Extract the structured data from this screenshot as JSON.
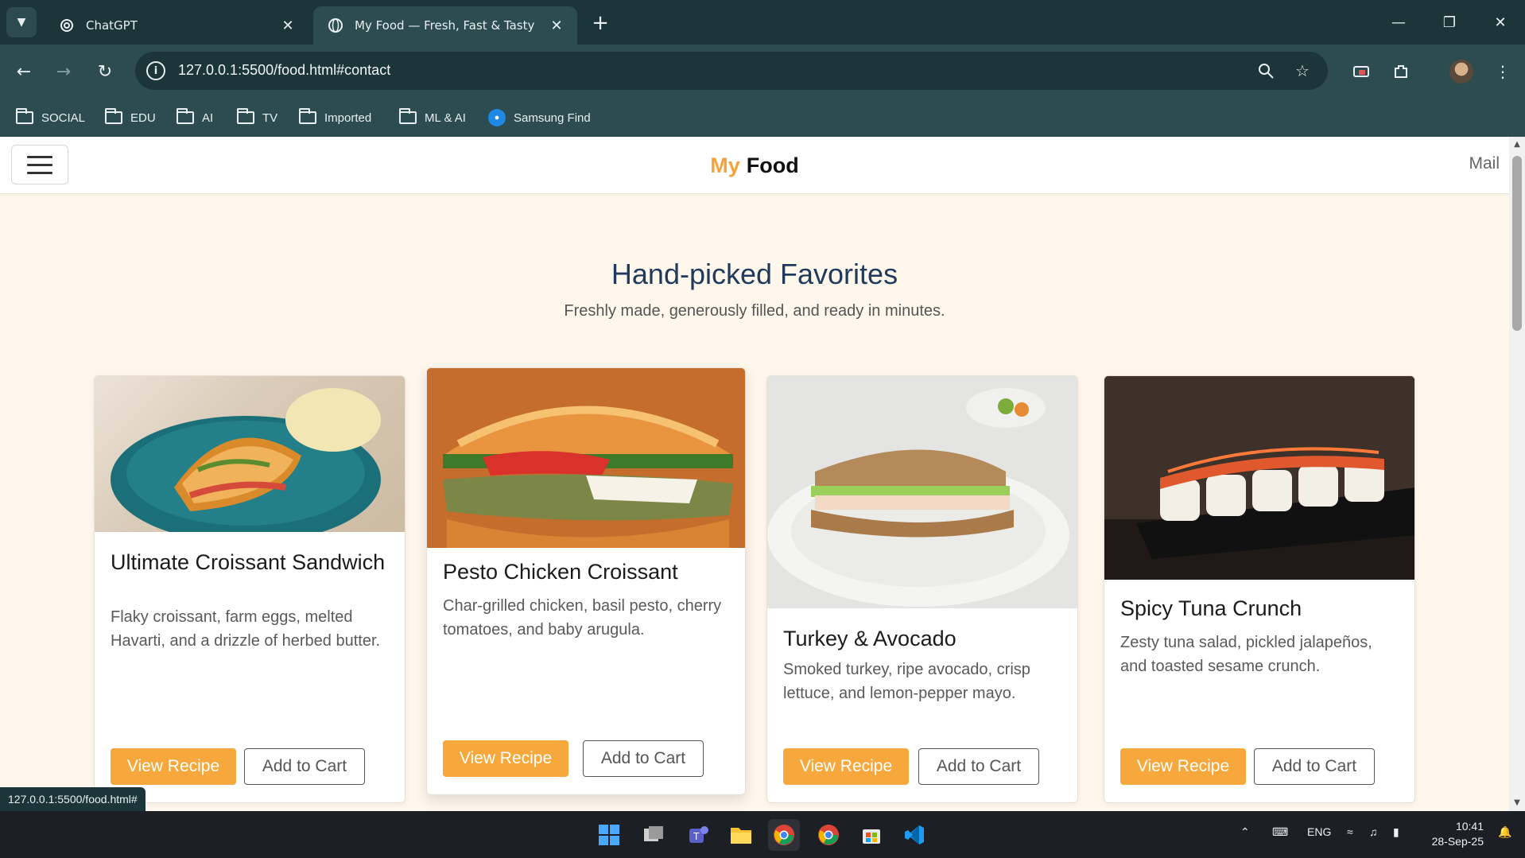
{
  "browser": {
    "tabs": [
      {
        "title": "ChatGPT",
        "active": false
      },
      {
        "title": "My Food — Fresh, Fast & Tasty",
        "active": true
      }
    ],
    "url": "127.0.0.1:5500/food.html#contact",
    "bookmarks": [
      "SOCIAL",
      "EDU",
      "AI",
      "TV",
      "Imported",
      "ML & AI",
      "Samsung Find"
    ],
    "status_url": "127.0.0.1:5500/food.html#"
  },
  "site": {
    "brand_my": "My",
    "brand_food": "Food",
    "mail_link": "Mail",
    "section_title": "Hand-picked Favorites",
    "section_subtitle": "Freshly made, generously filled, and ready in minutes.",
    "cards": [
      {
        "title": "Ultimate Croissant Sandwich",
        "description": "Flaky croissant, farm eggs, melted Havarti, and a drizzle of herbed butter.",
        "primary_label": "View Recipe",
        "secondary_label": "Add to Cart"
      },
      {
        "title": "Pesto Chicken Croissant",
        "description": "Char-grilled chicken, basil pesto, cherry tomatoes, and baby arugula.",
        "primary_label": "View Recipe",
        "secondary_label": "Add to Cart"
      },
      {
        "title": "Turkey & Avocado",
        "description": "Smoked turkey, ripe avocado, crisp lettuce, and lemon-pepper mayo.",
        "primary_label": "View Recipe",
        "secondary_label": "Add to Cart"
      },
      {
        "title": "Spicy Tuna Crunch",
        "description": "Zesty tuna salad, pickled jalapeños, and toasted sesame crunch.",
        "primary_label": "View Recipe",
        "secondary_label": "Add to Cart"
      }
    ]
  },
  "taskbar": {
    "language": "ENG",
    "time": "10:41",
    "date": "28-Sep-25"
  },
  "colors": {
    "brand_accent": "#f4a33b",
    "button_primary": "#f6a83c",
    "page_background": "#fff7ec",
    "heading": "#1f3a5c"
  }
}
